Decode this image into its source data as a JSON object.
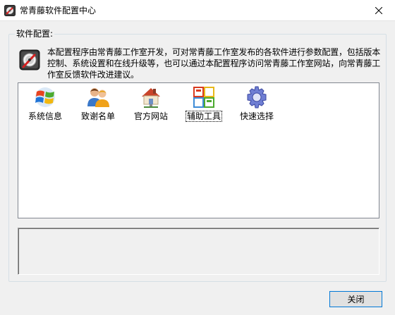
{
  "window": {
    "title": "常青藤软件配置中心"
  },
  "group": {
    "label": "软件配置:",
    "description": "本配置程序由常青藤工作室开发，可对常青藤工作室发布的各软件进行参数配置，包括版本控制、系统设置和在线升级等，也可以通过本配置程序访问常青藤工作室网站，向常青藤工作室反馈软件改进建议。"
  },
  "items": [
    {
      "label": "系统信息",
      "icon": "windows-flag-icon"
    },
    {
      "label": "致谢名单",
      "icon": "users-icon"
    },
    {
      "label": "官方网站",
      "icon": "home-network-icon"
    },
    {
      "label": "辅助工具",
      "icon": "tools-window-icon"
    },
    {
      "label": "快速选择",
      "icon": "gear-icon"
    }
  ],
  "buttons": {
    "close": "关闭"
  },
  "colors": {
    "accent": "#0078d7",
    "list_border": "#828790",
    "window_bg": "#f0f0f0"
  }
}
